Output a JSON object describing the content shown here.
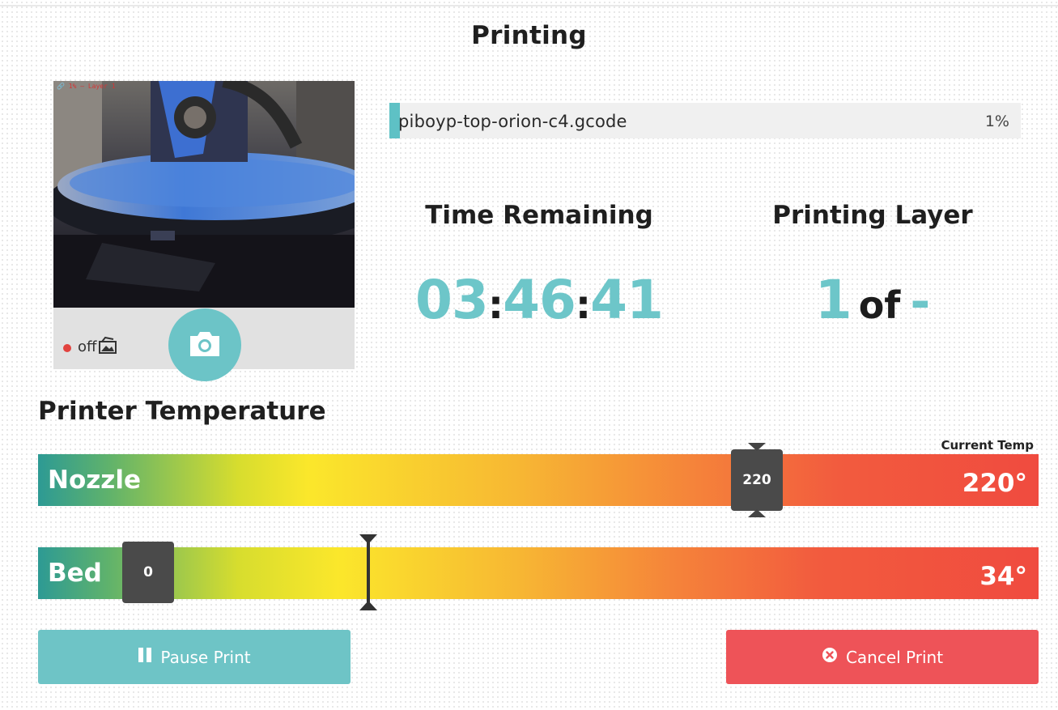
{
  "page": {
    "title": "Printing"
  },
  "camera": {
    "overlay_text": "🔗 1% — Layer 1",
    "recording_label": "off",
    "icons": {
      "recording": "red-dot-icon",
      "gallery": "gallery-icon",
      "snapshot": "camera-icon"
    }
  },
  "job": {
    "file_name": "piboyp-top-orion-c4.gcode",
    "progress_label": "1%",
    "progress_fraction": 0.01
  },
  "time_remaining": {
    "label": "Time Remaining",
    "hours": "03",
    "minutes": "46",
    "seconds": "41",
    "separator": ":"
  },
  "layer": {
    "label": "Printing Layer",
    "current": "1",
    "of": "of",
    "total": "-"
  },
  "temperature": {
    "title": "Printer Temperature",
    "current_label": "Current Temp",
    "nozzle": {
      "label": "Nozzle",
      "target": "220",
      "current": "220°"
    },
    "bed": {
      "label": "Bed",
      "target": "0",
      "current": "34°"
    }
  },
  "actions": {
    "pause_label": "Pause Print",
    "cancel_label": "Cancel Print"
  },
  "colors": {
    "accent": "#6dc6c9",
    "danger": "#ee5358",
    "handle": "#4a4a4a"
  }
}
